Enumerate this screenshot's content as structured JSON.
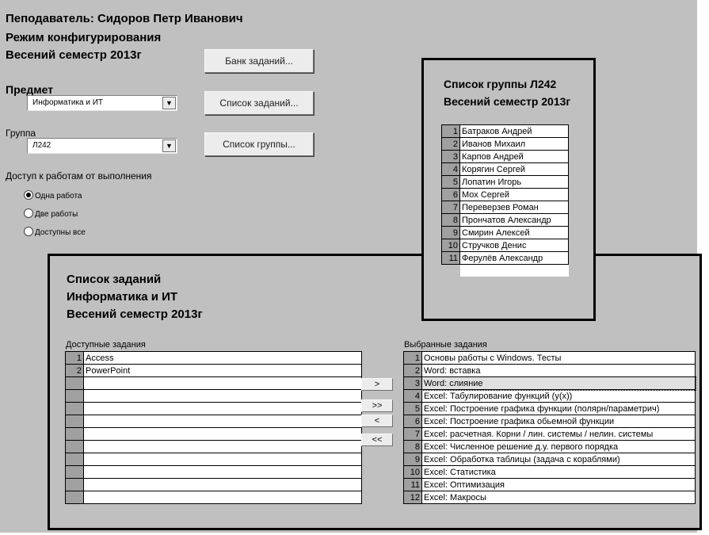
{
  "header": {
    "teacher": "Пеподаватель: Сидоров Петр Иванович",
    "mode": "Режим конфигурирования",
    "semester": "Весений семестр 2013г"
  },
  "buttons": {
    "task_bank": "Банк заданий...",
    "task_list": "Список заданий...",
    "group_list": "Список группы..."
  },
  "subject": {
    "label": "Предмет",
    "value": "Информатика и ИТ"
  },
  "group": {
    "label": "Группа",
    "value": "Л242"
  },
  "access": {
    "label": "Доступ к работам от выполнения",
    "options": [
      "Одна работа",
      "Две работы",
      "Доступны все"
    ],
    "selected": "Одна работа"
  },
  "group_panel": {
    "title1": "Список группы Л242",
    "title2": "Весений семестр 2013г",
    "students": [
      {
        "n": "1",
        "name": "Батраков Андрей"
      },
      {
        "n": "2",
        "name": "Иванов Михаил"
      },
      {
        "n": "3",
        "name": "Карпов Андрей"
      },
      {
        "n": "4",
        "name": "Корягин Сергей"
      },
      {
        "n": "5",
        "name": "Лопатин Игорь"
      },
      {
        "n": "6",
        "name": "Мох Сергей"
      },
      {
        "n": "7",
        "name": "Переверзев Роман"
      },
      {
        "n": "8",
        "name": "Прончатов Александр"
      },
      {
        "n": "9",
        "name": "Смирин Алексей"
      },
      {
        "n": "10",
        "name": "Стручков Денис"
      },
      {
        "n": "11",
        "name": "Ферулёв Александр"
      }
    ]
  },
  "tasks_panel": {
    "title1": "Список заданий",
    "title2": "Информатика и ИТ",
    "title3": "Весений семестр 2013г",
    "available_label": "Доступные задания",
    "selected_label": "Выбранные задания",
    "available": [
      {
        "n": "1",
        "name": "Access"
      },
      {
        "n": "2",
        "name": "PowerPoint"
      },
      {
        "n": "",
        "name": ""
      },
      {
        "n": "",
        "name": ""
      },
      {
        "n": "",
        "name": ""
      },
      {
        "n": "",
        "name": ""
      },
      {
        "n": "",
        "name": ""
      },
      {
        "n": "",
        "name": ""
      },
      {
        "n": "",
        "name": ""
      },
      {
        "n": "",
        "name": ""
      },
      {
        "n": "",
        "name": ""
      },
      {
        "n": "",
        "name": ""
      }
    ],
    "selected": [
      {
        "n": "1",
        "name": "Основы работы с Windows. Тесты"
      },
      {
        "n": "2",
        "name": "Word: вставка"
      },
      {
        "n": "3",
        "name": "Word: слияние"
      },
      {
        "n": "4",
        "name": "Excel: Табулирование функций (y(x))"
      },
      {
        "n": "5",
        "name": "Excel: Построение графика функции (полярн/параметрич)"
      },
      {
        "n": "6",
        "name": "Excel: Построение графика обьемной функции"
      },
      {
        "n": "7",
        "name": "Excel: расчетная. Корни / лин. системы / нелин. системы"
      },
      {
        "n": "8",
        "name": "Excel: Численное решение д.у. первого порядка"
      },
      {
        "n": "9",
        "name": "Excel: Обработка таблицы (задача с кораблями)"
      },
      {
        "n": "10",
        "name": "Excel: Статистика"
      },
      {
        "n": "11",
        "name": "Excel: Оптимизация"
      },
      {
        "n": "12",
        "name": "Excel: Макросы"
      }
    ],
    "move_buttons": [
      ">",
      ">>",
      "<",
      "<<"
    ]
  }
}
